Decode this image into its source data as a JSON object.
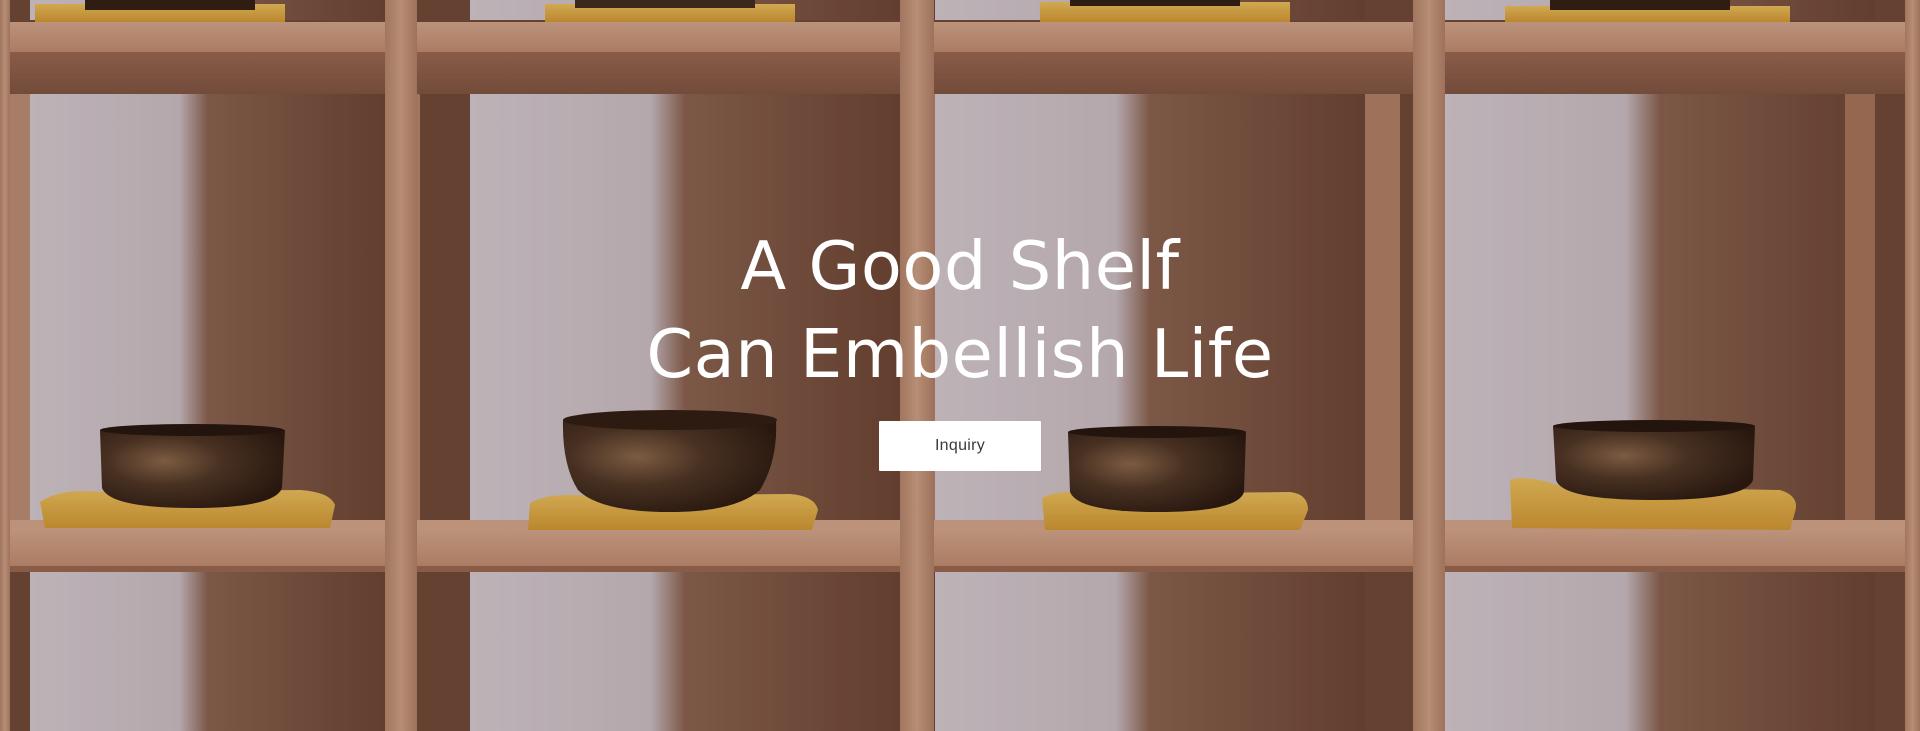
{
  "hero": {
    "headline_line1": "A Good Shelf",
    "headline_line2": "Can Embellish Life",
    "inquiry_label": "Inquiry"
  },
  "colors": {
    "headline_text": "#ffffff",
    "button_background": "#ffffff",
    "button_text": "#3b3b3b",
    "shelf_wood": "#c99a80",
    "cubby_back": "#6e4a3a",
    "wall": "#d8d3da",
    "cushion": "#e8b64a",
    "bowl": "#3a2a20"
  }
}
